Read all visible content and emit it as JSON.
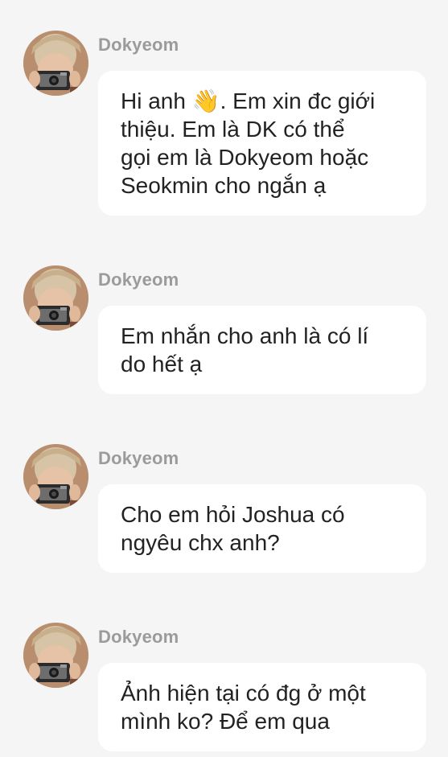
{
  "messages": [
    {
      "sender": "Dokyeom",
      "lines": [
        "Hi anh 👋. Em xin đc giới",
        "thiệu. Em là DK có thể",
        "gọi em là Dokyeom hoặc",
        "Seokmin cho ngắn ạ"
      ]
    },
    {
      "sender": "Dokyeom",
      "lines": [
        "Em nhắn cho anh là có lí",
        "do hết ạ"
      ]
    },
    {
      "sender": "Dokyeom",
      "lines": [
        "Cho em hỏi Joshua có",
        "ngyêu chx anh?"
      ]
    },
    {
      "sender": "Dokyeom",
      "lines": [
        "Ảnh hiện tại có đg ở một",
        "mình ko? Để em qua"
      ]
    }
  ]
}
